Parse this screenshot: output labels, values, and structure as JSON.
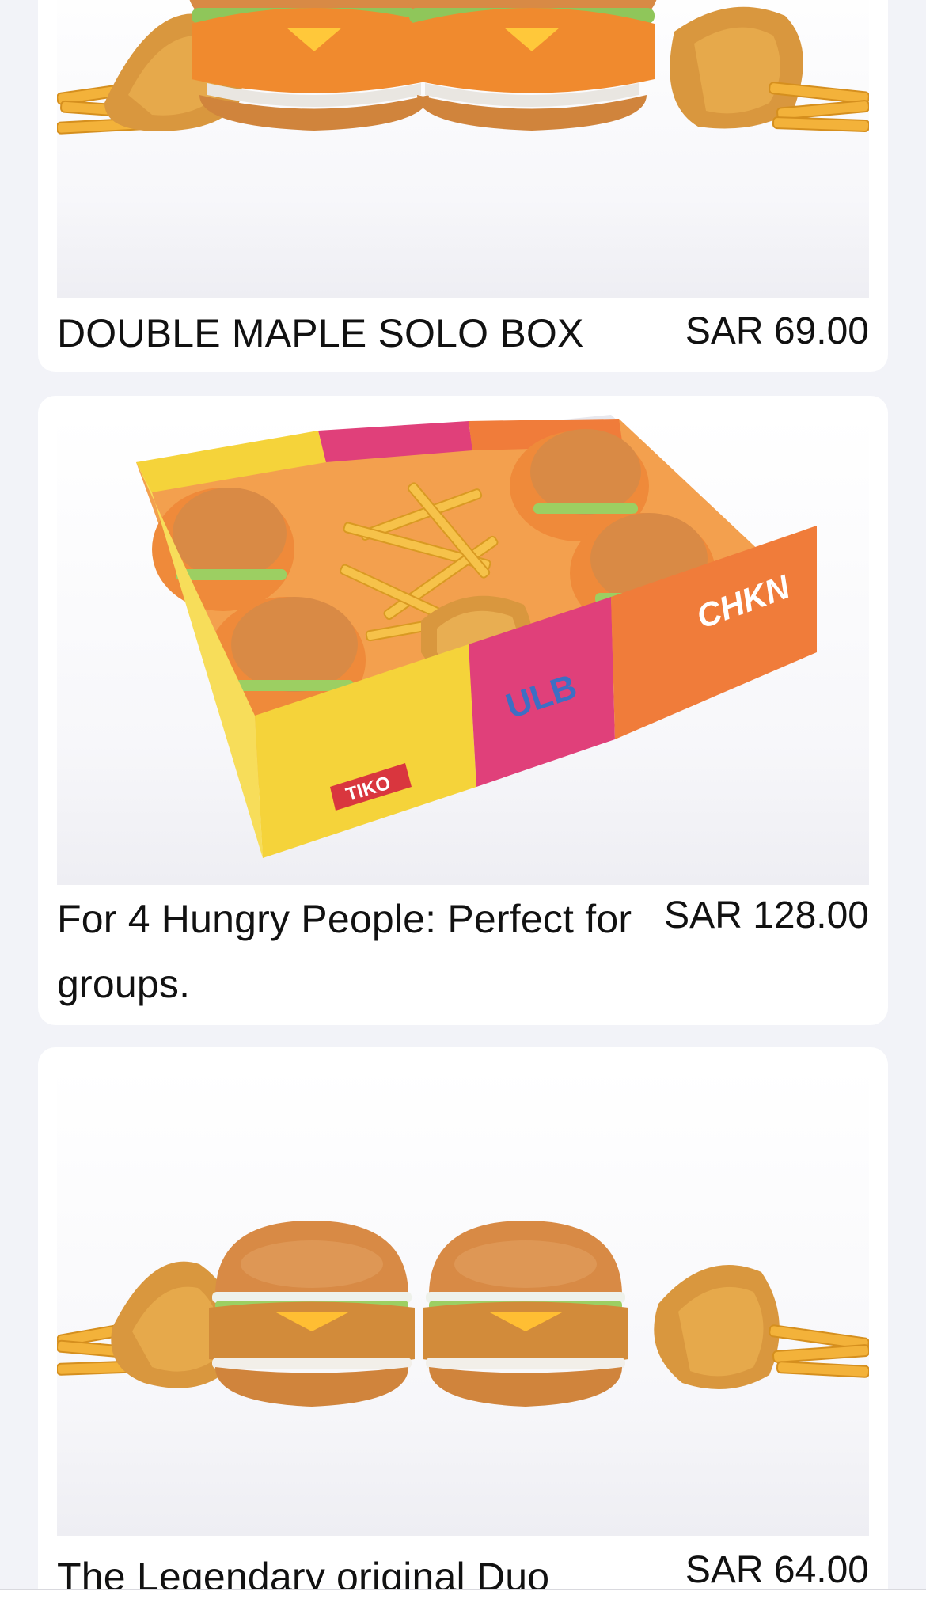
{
  "menu": {
    "items": [
      {
        "name": "DOUBLE MAPLE SOLO BOX",
        "price": "SAR 69.00",
        "image": "double-maple-burgers-with-tenders-and-fries"
      },
      {
        "name": "For 4 Hungry People: Perfect for groups.",
        "price": "SAR 128.00",
        "image": "group-box-four-burgers-fries-tenders",
        "box_labels": [
          "TIKO",
          "ULB",
          "CHKN"
        ]
      },
      {
        "name": "The Legendary original Duo",
        "price": "SAR 64.00",
        "image": "original-duo-burgers-with-tenders-and-fries"
      }
    ]
  },
  "colors": {
    "page_background": "#f2f3f8",
    "card_background": "#ffffff",
    "text": "#111111",
    "box_yellow": "#f5d33a",
    "box_pink": "#e0407a",
    "box_orange": "#f07c3a"
  }
}
